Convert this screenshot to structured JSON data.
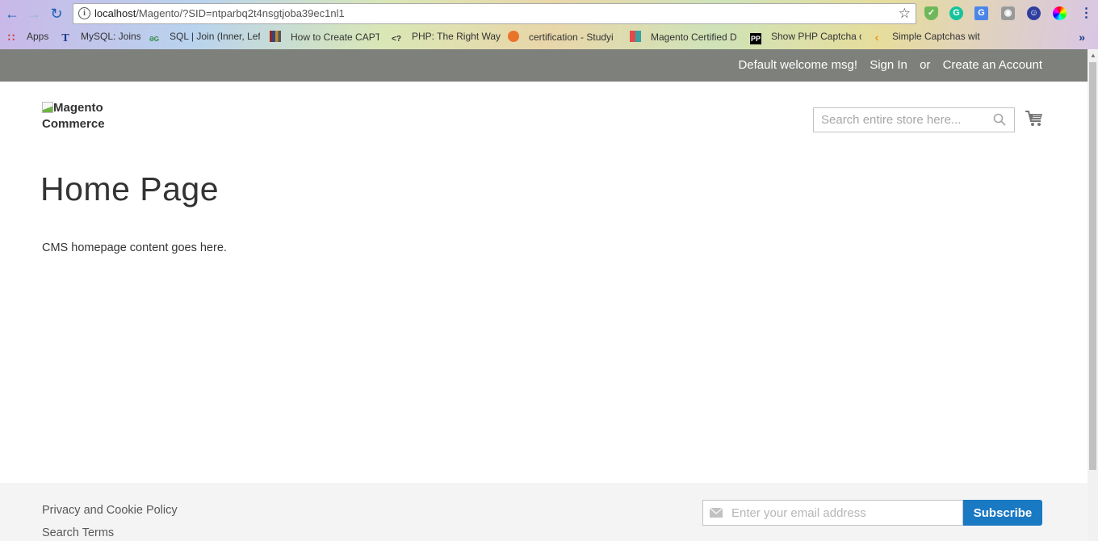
{
  "browser": {
    "url_host": "localhost",
    "url_path": "/Magento/?SID=ntparbq2t4nsgtjoba39ec1nl1",
    "bookmarks": [
      {
        "label": "Apps",
        "icon": "apps-grid-icon"
      },
      {
        "label": "MySQL: Joins",
        "icon": "t-icon"
      },
      {
        "label": "SQL | Join (Inner, Lef",
        "icon": "gfg-icon"
      },
      {
        "label": "How to Create CAPT",
        "icon": "books-icon"
      },
      {
        "label": "PHP: The Right Way",
        "icon": "php-icon"
      },
      {
        "label": "certification - Studyi",
        "icon": "studyin-icon"
      },
      {
        "label": "Magento Certified D",
        "icon": "magento-cert-icon"
      },
      {
        "label": "Show PHP Captcha c",
        "icon": "pp-icon"
      },
      {
        "label": "Simple Captchas wit",
        "icon": "code-icon"
      }
    ],
    "bookmark_glyphs": {
      "t": "T",
      "gfg": "ƏG",
      "php": "<?",
      "pp": "PP",
      "more": "»"
    }
  },
  "header": {
    "welcome": "Default welcome msg!",
    "sign_in": "Sign In",
    "or": "or",
    "create_account": "Create an Account"
  },
  "logo": {
    "alt_text": "Magento Commerce"
  },
  "search": {
    "placeholder": "Search entire store here..."
  },
  "main": {
    "title": "Home Page",
    "content": "CMS homepage content goes here."
  },
  "footer": {
    "links": [
      "Privacy and Cookie Policy",
      "Search Terms"
    ],
    "newsletter_placeholder": "Enter your email address",
    "subscribe_label": "Subscribe"
  },
  "colors": {
    "header_bg": "#7e807c",
    "subscribe_bg": "#1979c3",
    "footer_bg": "#f4f4f4"
  }
}
